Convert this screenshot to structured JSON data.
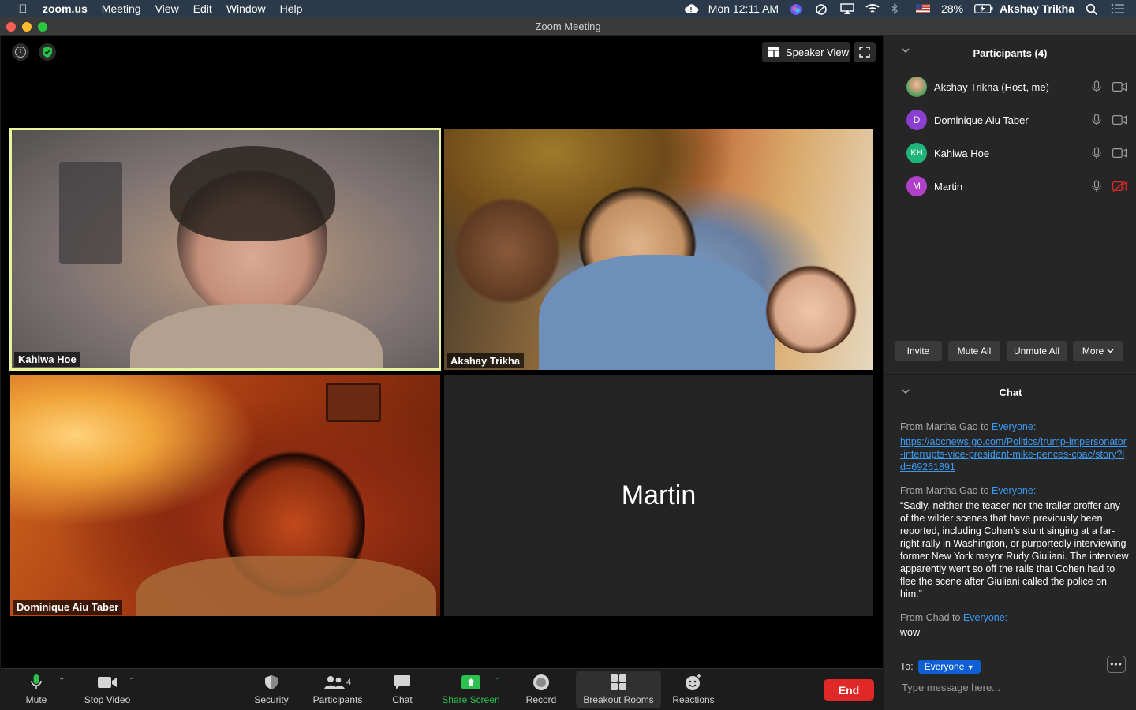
{
  "menubar": {
    "app": "zoom.us",
    "items": [
      "Meeting",
      "View",
      "Edit",
      "Window",
      "Help"
    ],
    "clock": "Mon 12:11 AM",
    "battery": "28%",
    "user": "Akshay Trikha"
  },
  "window": {
    "title": "Zoom Meeting"
  },
  "video": {
    "view_label": "Speaker View",
    "tiles": {
      "kahiwa": "Kahiwa Hoe",
      "akshay": "Akshay Trikha",
      "dominique": "Dominique Aiu Taber",
      "martin": "Martin"
    }
  },
  "toolbar": {
    "mute": "Mute",
    "stop_video": "Stop Video",
    "security": "Security",
    "participants": "Participants",
    "participants_count": "4",
    "chat": "Chat",
    "share_screen": "Share Screen",
    "record": "Record",
    "breakout_rooms": "Breakout Rooms",
    "reactions": "Reactions",
    "end": "End"
  },
  "participants_panel": {
    "title": "Participants (4)",
    "people": [
      {
        "name": "Akshay Trikha (Host, me)",
        "initials": "",
        "color": "#6aa86a",
        "video_off": false
      },
      {
        "name": "Dominique Aiu Taber",
        "initials": "D",
        "color": "#8a3fd1",
        "video_off": false
      },
      {
        "name": "Kahiwa Hoe",
        "initials": "KH",
        "color": "#1fb57a",
        "video_off": false
      },
      {
        "name": "Martin",
        "initials": "M",
        "color": "#b03fc9",
        "video_off": true
      }
    ],
    "actions": {
      "invite": "Invite",
      "mute_all": "Mute All",
      "unmute_all": "Unmute All",
      "more": "More"
    }
  },
  "chat": {
    "title": "Chat",
    "messages": [
      {
        "from": "From Martha Gao to ",
        "to": "Everyone:",
        "body": "https://abcnews.go.com/Politics/trump-impersonator-interrupts-vice-president-mike-pences-cpac/story?id=69261891"
      },
      {
        "from": "From Martha Gao to ",
        "to": "Everyone:",
        "body": "“Sadly, neither the teaser nor the trailer proffer any of the wilder scenes that have previously been reported, including Cohen’s stunt singing at a far-right rally in Washington, or purportedly interviewing former New York mayor Rudy Giuliani. The interview apparently went so off the rails that Cohen had to flee the scene after Giuliani called the police on him.”"
      },
      {
        "from": "From Chad to ",
        "to": "Everyone:",
        "body": "wow"
      }
    ],
    "to_label": "To:",
    "recipient": "Everyone",
    "input_placeholder": "Type message here..."
  },
  "colors": {
    "end_red": "#e02828",
    "link_blue": "#3a9bf5",
    "share_green": "#2cc14e",
    "active_border": "#e8f59a"
  }
}
